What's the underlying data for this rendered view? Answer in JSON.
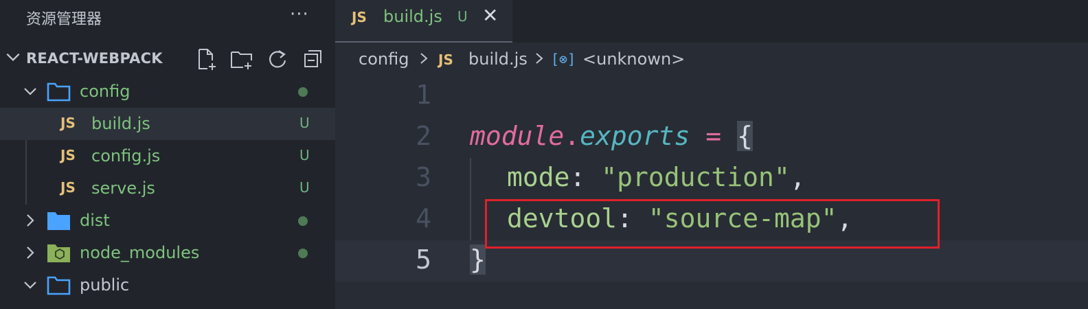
{
  "sidebar": {
    "title": "资源管理器",
    "more": "···",
    "section_title": "REACT-WEBPACK",
    "tree": [
      {
        "name": "config",
        "kind": "folder-open",
        "status": "dot"
      },
      {
        "name": "build.js",
        "kind": "js",
        "badge": "U",
        "selected": true
      },
      {
        "name": "config.js",
        "kind": "js",
        "badge": "U"
      },
      {
        "name": "serve.js",
        "kind": "js",
        "badge": "U"
      },
      {
        "name": "dist",
        "kind": "folder-closed",
        "status": "dot"
      },
      {
        "name": "node_modules",
        "kind": "node-folder",
        "status": "dot"
      },
      {
        "name": "public",
        "kind": "folder-open"
      }
    ]
  },
  "tab": {
    "js": "JS",
    "name": "build.js",
    "badge": "U",
    "close": "✕"
  },
  "breadcrumb": {
    "folder": "config",
    "js": "JS",
    "file": "build.js",
    "sym_icon": "[⊗]",
    "symbol": "<unknown>"
  },
  "code": {
    "lines": [
      "1",
      "2",
      "3",
      "4",
      "5"
    ],
    "l2_module": "module",
    "l2_dot": ".",
    "l2_exports": "exports",
    "l2_eq": " = ",
    "l2_brace": "{",
    "l3_key": "mode",
    "l3_colon": ": ",
    "l3_val": "\"production\"",
    "l3_comma": ",",
    "l4_key": "devtool",
    "l4_colon": ": ",
    "l4_val": "\"source-map\"",
    "l4_comma": ",",
    "l5_brace": "}"
  },
  "colors": {
    "accent_folder": "#4aa3ff",
    "js": "#e5c07b",
    "untracked": "#6fb383",
    "highlight": "#e0212a"
  }
}
